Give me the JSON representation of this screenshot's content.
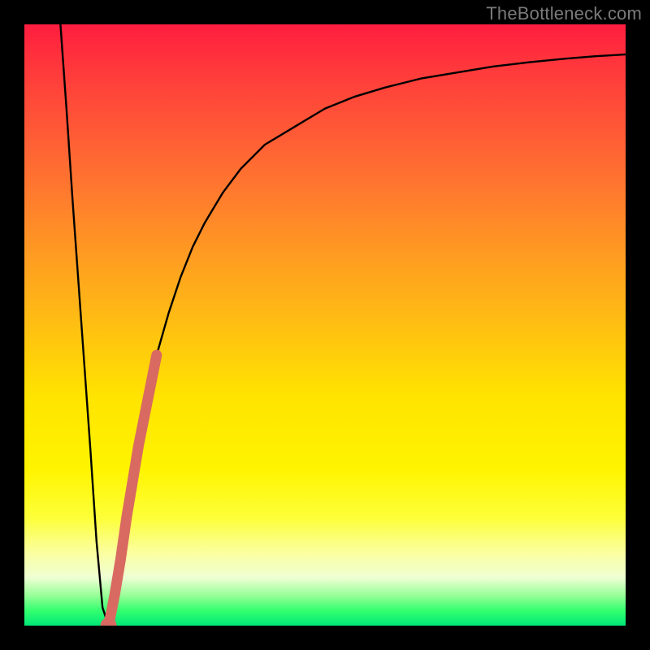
{
  "watermark": "TheBottleneck.com",
  "colors": {
    "frame": "#000000",
    "curve": "#000000",
    "marker": "#d96a61"
  },
  "chart_data": {
    "type": "line",
    "title": "",
    "xlabel": "",
    "ylabel": "",
    "xlim": [
      0,
      100
    ],
    "ylim": [
      0,
      100
    ],
    "grid": false,
    "legend": false,
    "series": [
      {
        "name": "left-branch",
        "x": [
          6,
          7,
          8,
          9,
          10,
          11,
          12,
          13,
          14
        ],
        "y": [
          100,
          86,
          71,
          57,
          43,
          29,
          14,
          3,
          0
        ]
      },
      {
        "name": "right-branch",
        "x": [
          14,
          15,
          16,
          17,
          18,
          19,
          20,
          21,
          22,
          24,
          26,
          28,
          30,
          33,
          36,
          40,
          45,
          50,
          55,
          60,
          66,
          72,
          78,
          84,
          90,
          95,
          100
        ],
        "y": [
          0,
          5,
          11,
          18,
          24,
          30,
          35,
          40,
          45,
          52,
          58,
          63,
          67,
          72,
          76,
          80,
          83,
          86,
          88,
          89.5,
          91,
          92,
          93,
          93.7,
          94.3,
          94.7,
          95
        ]
      },
      {
        "name": "marker-segment",
        "x": [
          14,
          15,
          16,
          17,
          18,
          19,
          20,
          21,
          22
        ],
        "y": [
          0,
          5,
          11,
          18,
          24,
          30,
          35,
          40,
          45
        ]
      }
    ],
    "marker": {
      "x": 14,
      "y": 0
    }
  }
}
